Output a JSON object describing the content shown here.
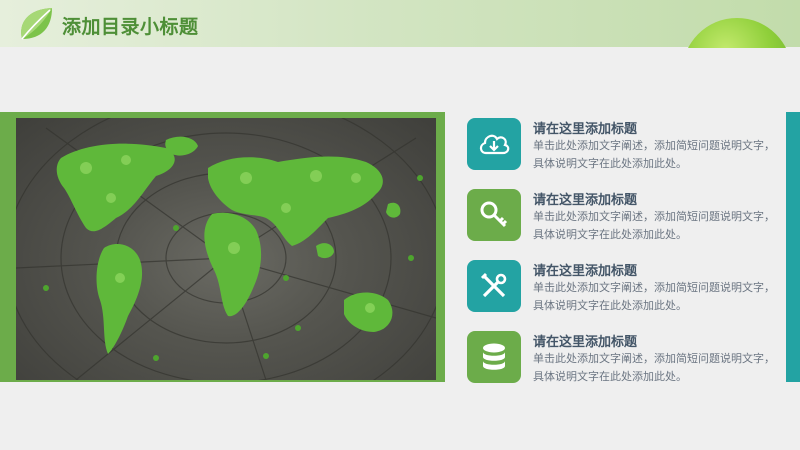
{
  "header": {
    "title": "添加目录小标题"
  },
  "items": [
    {
      "icon": "cloud-download-icon",
      "title": "请在这里添加标题",
      "desc": "单击此处添加文字阐述，添加简短问题说明文字，具体说明文字在此处添加此处。"
    },
    {
      "icon": "key-icon",
      "title": "请在这里添加标题",
      "desc": "单击此处添加文字阐述，添加简短问题说明文字，具体说明文字在此处添加此处。"
    },
    {
      "icon": "tools-icon",
      "title": "请在这里添加标题",
      "desc": "单击此处添加文字阐述，添加简短问题说明文字，具体说明文字在此处添加此处。"
    },
    {
      "icon": "database-icon",
      "title": "请在这里添加标题",
      "desc": "单击此处添加文字阐述，添加简短问题说明文字，具体说明文字在此处添加此处。"
    }
  ],
  "colors": {
    "teal": "#23a3a3",
    "green": "#6cac4a",
    "title_green": "#4e8f37",
    "item_title": "#445668",
    "item_text": "#6b7582"
  }
}
